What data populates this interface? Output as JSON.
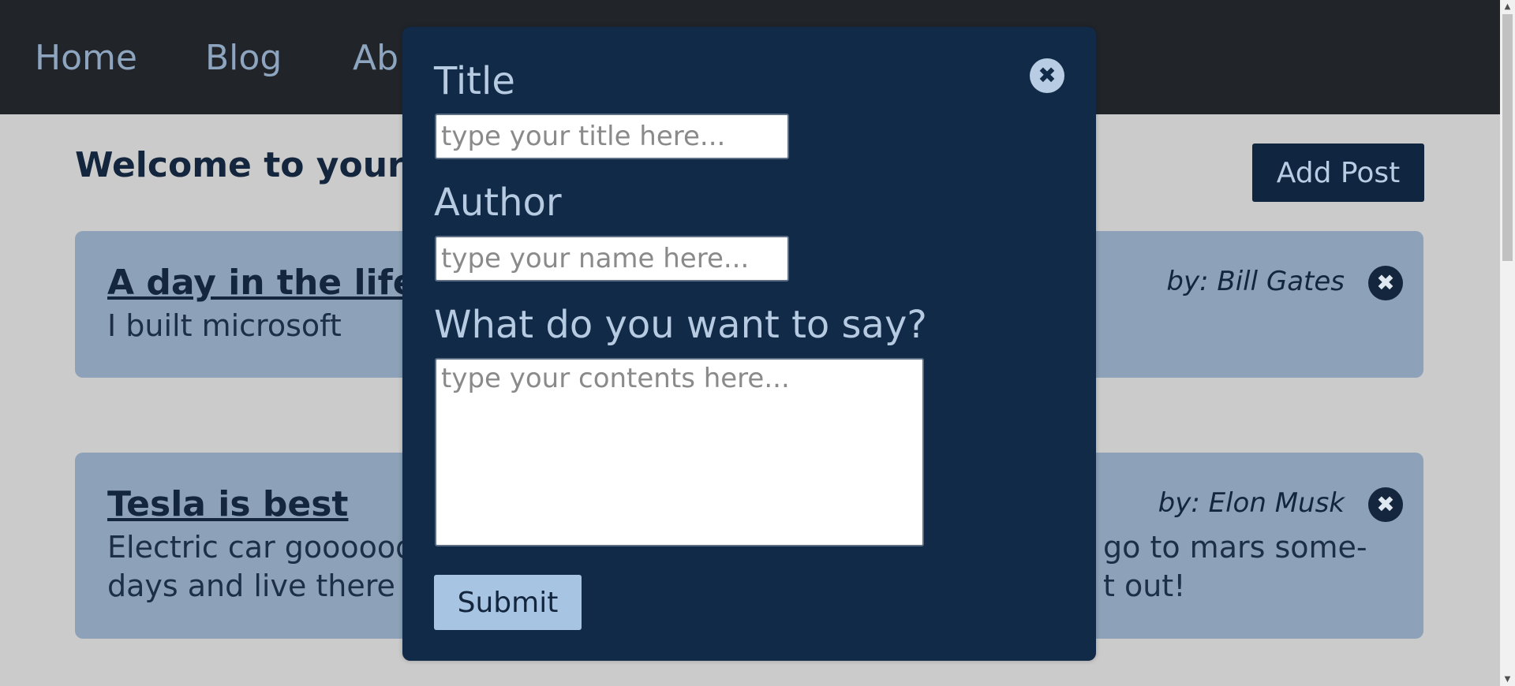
{
  "nav": {
    "home": "Home",
    "blog": "Blog",
    "about": "Ab"
  },
  "main": {
    "welcome": "Welcome to your H",
    "add_post_label": "Add Post"
  },
  "posts": [
    {
      "title": "A day in the life o",
      "body": "I built microsoft",
      "author": "by: Bill Gates",
      "close_icon": "close-icon"
    },
    {
      "title": "Tesla is best",
      "body_left_line1": "Electric car goooood",
      "body_right_line1": "go to mars some-",
      "body_left_line2": "days and live there",
      "body_right_line2": "t out!",
      "author": "by: Elon Musk",
      "close_icon": "close-icon"
    }
  ],
  "modal": {
    "title_label": "Title",
    "title_placeholder": "type your title here...",
    "author_label": "Author",
    "author_placeholder": "type your name here...",
    "contents_label": "What do you want to say?",
    "contents_placeholder": "type your contents here...",
    "submit_label": "Submit",
    "close_icon": "close-icon"
  },
  "colors": {
    "nav_bg": "#212429",
    "page_bg": "#cbcbcb",
    "card_bg": "#8da1b8",
    "modal_bg": "#112a47",
    "accent_light": "#a7c4e2",
    "dark_text": "#13263d"
  }
}
